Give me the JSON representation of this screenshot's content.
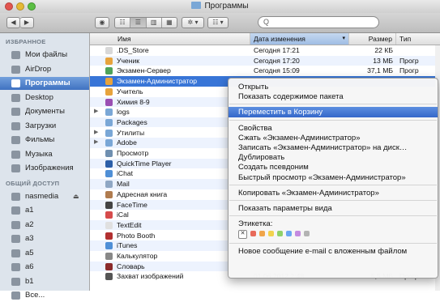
{
  "window": {
    "title": "Программы"
  },
  "toolbar": {
    "back": "◀",
    "forward": "▶",
    "views": [
      "☷",
      "☰",
      "▥",
      "▦"
    ],
    "action": "✲ ▾",
    "arrange": "☷ ▾",
    "search_placeholder": "",
    "search_icon": "Q"
  },
  "sidebar": {
    "favorites_header": "ИЗБРАННОЕ",
    "shared_header": "ОБЩИЙ ДОСТУП",
    "favorites": [
      {
        "label": "Мои файлы",
        "icon": "all-files-icon"
      },
      {
        "label": "AirDrop",
        "icon": "airdrop-icon"
      },
      {
        "label": "Программы",
        "icon": "applications-icon"
      },
      {
        "label": "Desktop",
        "icon": "desktop-icon"
      },
      {
        "label": "Документы",
        "icon": "documents-icon"
      },
      {
        "label": "Загрузки",
        "icon": "downloads-icon"
      },
      {
        "label": "Фильмы",
        "icon": "movies-icon"
      },
      {
        "label": "Музыка",
        "icon": "music-icon"
      },
      {
        "label": "Изображения",
        "icon": "pictures-icon"
      }
    ],
    "shared": [
      {
        "label": "nasmedia",
        "icon": "network-drive-icon",
        "eject": "⏏"
      },
      {
        "label": "a1",
        "icon": "computer-icon"
      },
      {
        "label": "a2",
        "icon": "computer-icon"
      },
      {
        "label": "a3",
        "icon": "computer-icon"
      },
      {
        "label": "a5",
        "icon": "computer-icon"
      },
      {
        "label": "a6",
        "icon": "computer-icon"
      },
      {
        "label": "b1",
        "icon": "computer-icon"
      },
      {
        "label": "Все...",
        "icon": "network-icon"
      }
    ]
  },
  "list": {
    "columns": {
      "name": "Имя",
      "date": "Дата изменения",
      "size": "Размер",
      "type": "Тип"
    },
    "rows": [
      {
        "name": ".DS_Store",
        "date": "Сегодня 17:21",
        "size": "22 КБ",
        "type": "",
        "color": "#d8d8d8"
      },
      {
        "name": "Ученик",
        "date": "Сегодня 17:20",
        "size": "13 МБ",
        "type": "Прогр",
        "color": "#e7a33c"
      },
      {
        "name": "Экзамен-Сервер",
        "date": "Сегодня 15:09",
        "size": "37,1 МБ",
        "type": "Прогр",
        "color": "#4ea35a"
      },
      {
        "name": "Экзамен-Администратор",
        "date": "",
        "size": "",
        "type": "",
        "color": "#e7a33c"
      },
      {
        "name": "Учитель",
        "date": "",
        "size": "",
        "type": "",
        "color": "#e7a33c"
      },
      {
        "name": "Химия 8-9",
        "date": "",
        "size": "",
        "type": "",
        "color": "#9a4fb3"
      },
      {
        "name": "logs",
        "date": "",
        "size": "",
        "type": "",
        "color": "#7aa7d6",
        "folder": true
      },
      {
        "name": "Packages",
        "date": "",
        "size": "",
        "type": "",
        "color": "#7aa7d6"
      },
      {
        "name": "Утилиты",
        "date": "",
        "size": "",
        "type": "",
        "color": "#7aa7d6",
        "folder": true
      },
      {
        "name": "Adobe",
        "date": "",
        "size": "",
        "type": "",
        "color": "#7aa7d6",
        "folder": true
      },
      {
        "name": "Просмотр",
        "date": "",
        "size": "",
        "type": "",
        "color": "#6f8fb0"
      },
      {
        "name": "QuickTime Player",
        "date": "",
        "size": "",
        "type": "",
        "color": "#2c5fa8"
      },
      {
        "name": "iChat",
        "date": "",
        "size": "",
        "type": "",
        "color": "#4f8fd6"
      },
      {
        "name": "Mail",
        "date": "",
        "size": "",
        "type": "",
        "color": "#8fa7c4"
      },
      {
        "name": "Адресная книга",
        "date": "",
        "size": "",
        "type": "",
        "color": "#b07c4f"
      },
      {
        "name": "FaceTime",
        "date": "",
        "size": "",
        "type": "",
        "color": "#444"
      },
      {
        "name": "iCal",
        "date": "",
        "size": "",
        "type": "",
        "color": "#d64b4b"
      },
      {
        "name": "TextEdit",
        "date": "",
        "size": "",
        "type": "",
        "color": "#e0e0e0"
      },
      {
        "name": "Photo Booth",
        "date": "",
        "size": "",
        "type": "",
        "color": "#b23030"
      },
      {
        "name": "iTunes",
        "date": "",
        "size": "",
        "type": "",
        "color": "#4f8fd6"
      },
      {
        "name": "Калькулятор",
        "date": "",
        "size": "",
        "type": "",
        "color": "#888"
      },
      {
        "name": "Словарь",
        "date": "",
        "size": "",
        "type": "",
        "color": "#8b2b2b"
      },
      {
        "name": "Захват изображений",
        "date": "01.06.2012 2:48",
        "size": "5,5 МБ",
        "type": "Прогр",
        "color": "#555"
      }
    ],
    "selected_index": 3
  },
  "context_menu": {
    "items": [
      {
        "label": "Открыть"
      },
      {
        "label": "Показать содержимое пакета"
      },
      {
        "sep": true
      },
      {
        "label": "Переместить в Корзину",
        "highlighted": true
      },
      {
        "sep": true
      },
      {
        "label": "Свойства"
      },
      {
        "label": "Сжать «Экзамен-Администратор»"
      },
      {
        "label": "Записать «Экзамен-Администратор» на диск…"
      },
      {
        "label": "Дублировать"
      },
      {
        "label": "Создать псевдоним"
      },
      {
        "label": "Быстрый просмотр «Экзамен-Администратор»"
      },
      {
        "sep": true
      },
      {
        "label": "Копировать «Экзамен-Администратор»"
      },
      {
        "sep": true
      },
      {
        "label": "Показать параметры вида"
      },
      {
        "sep": true
      },
      {
        "label": "Этикетка:"
      },
      {
        "tags": true
      },
      {
        "sep": true
      },
      {
        "label": "Новое сообщение e-mail с вложенным файлом"
      }
    ],
    "label_close": "✕",
    "label_colors": [
      "#e86a5a",
      "#f0a54a",
      "#f2d34e",
      "#8fd16a",
      "#6ba6f2",
      "#c48ae0",
      "#b3b3b3"
    ]
  }
}
